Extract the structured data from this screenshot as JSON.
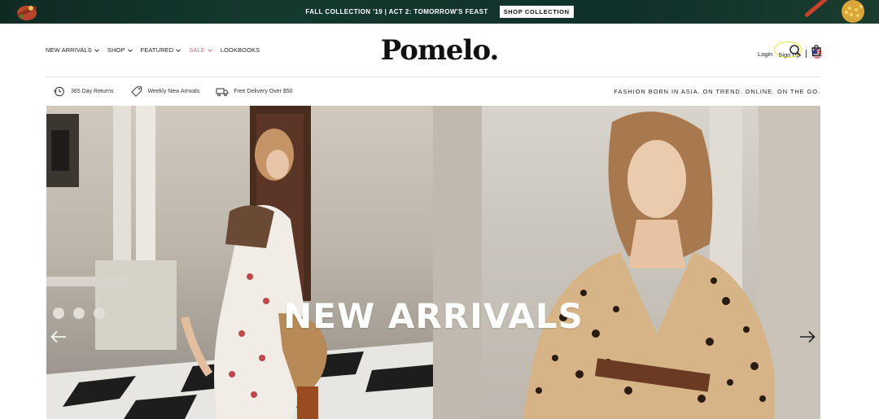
{
  "promo": {
    "text": "FALL COLLECTION '19 | ACT 2: TOMORROW'S FEAST",
    "button_label": "SHOP COLLECTION"
  },
  "header": {
    "logo": "Pomelo.",
    "nav": [
      {
        "label": "NEW ARRIVALS",
        "has_dropdown": true
      },
      {
        "label": "SHOP",
        "has_dropdown": true
      },
      {
        "label": "FEATURED",
        "has_dropdown": true
      },
      {
        "label": "SALE",
        "has_dropdown": true
      },
      {
        "label": "LOOKBOOKS",
        "has_dropdown": false
      }
    ],
    "login_label": "Login",
    "signup_label": "Sign Up",
    "icons": [
      "us-flag-icon",
      "search-icon",
      "shopping-bag-icon"
    ]
  },
  "strip": {
    "perks": [
      {
        "icon": "returns-clock-icon",
        "label": "365 Day Returns"
      },
      {
        "icon": "tag-icon",
        "label": "Weekly New Arrivals"
      },
      {
        "icon": "delivery-truck-icon",
        "label": "Free Delivery Over $50"
      }
    ],
    "tagline": "FASHION BORN IN ASIA. ON TREND. ONLINE. ON THE GO."
  },
  "hero": {
    "title": "NEW ARRIVALS",
    "icons": [
      "arrow-left-icon",
      "arrow-right-icon"
    ]
  },
  "colors": {
    "sale": "#d86a7e",
    "promo_bg": "#143a2e",
    "signup_highlight": "#f0e53a"
  }
}
